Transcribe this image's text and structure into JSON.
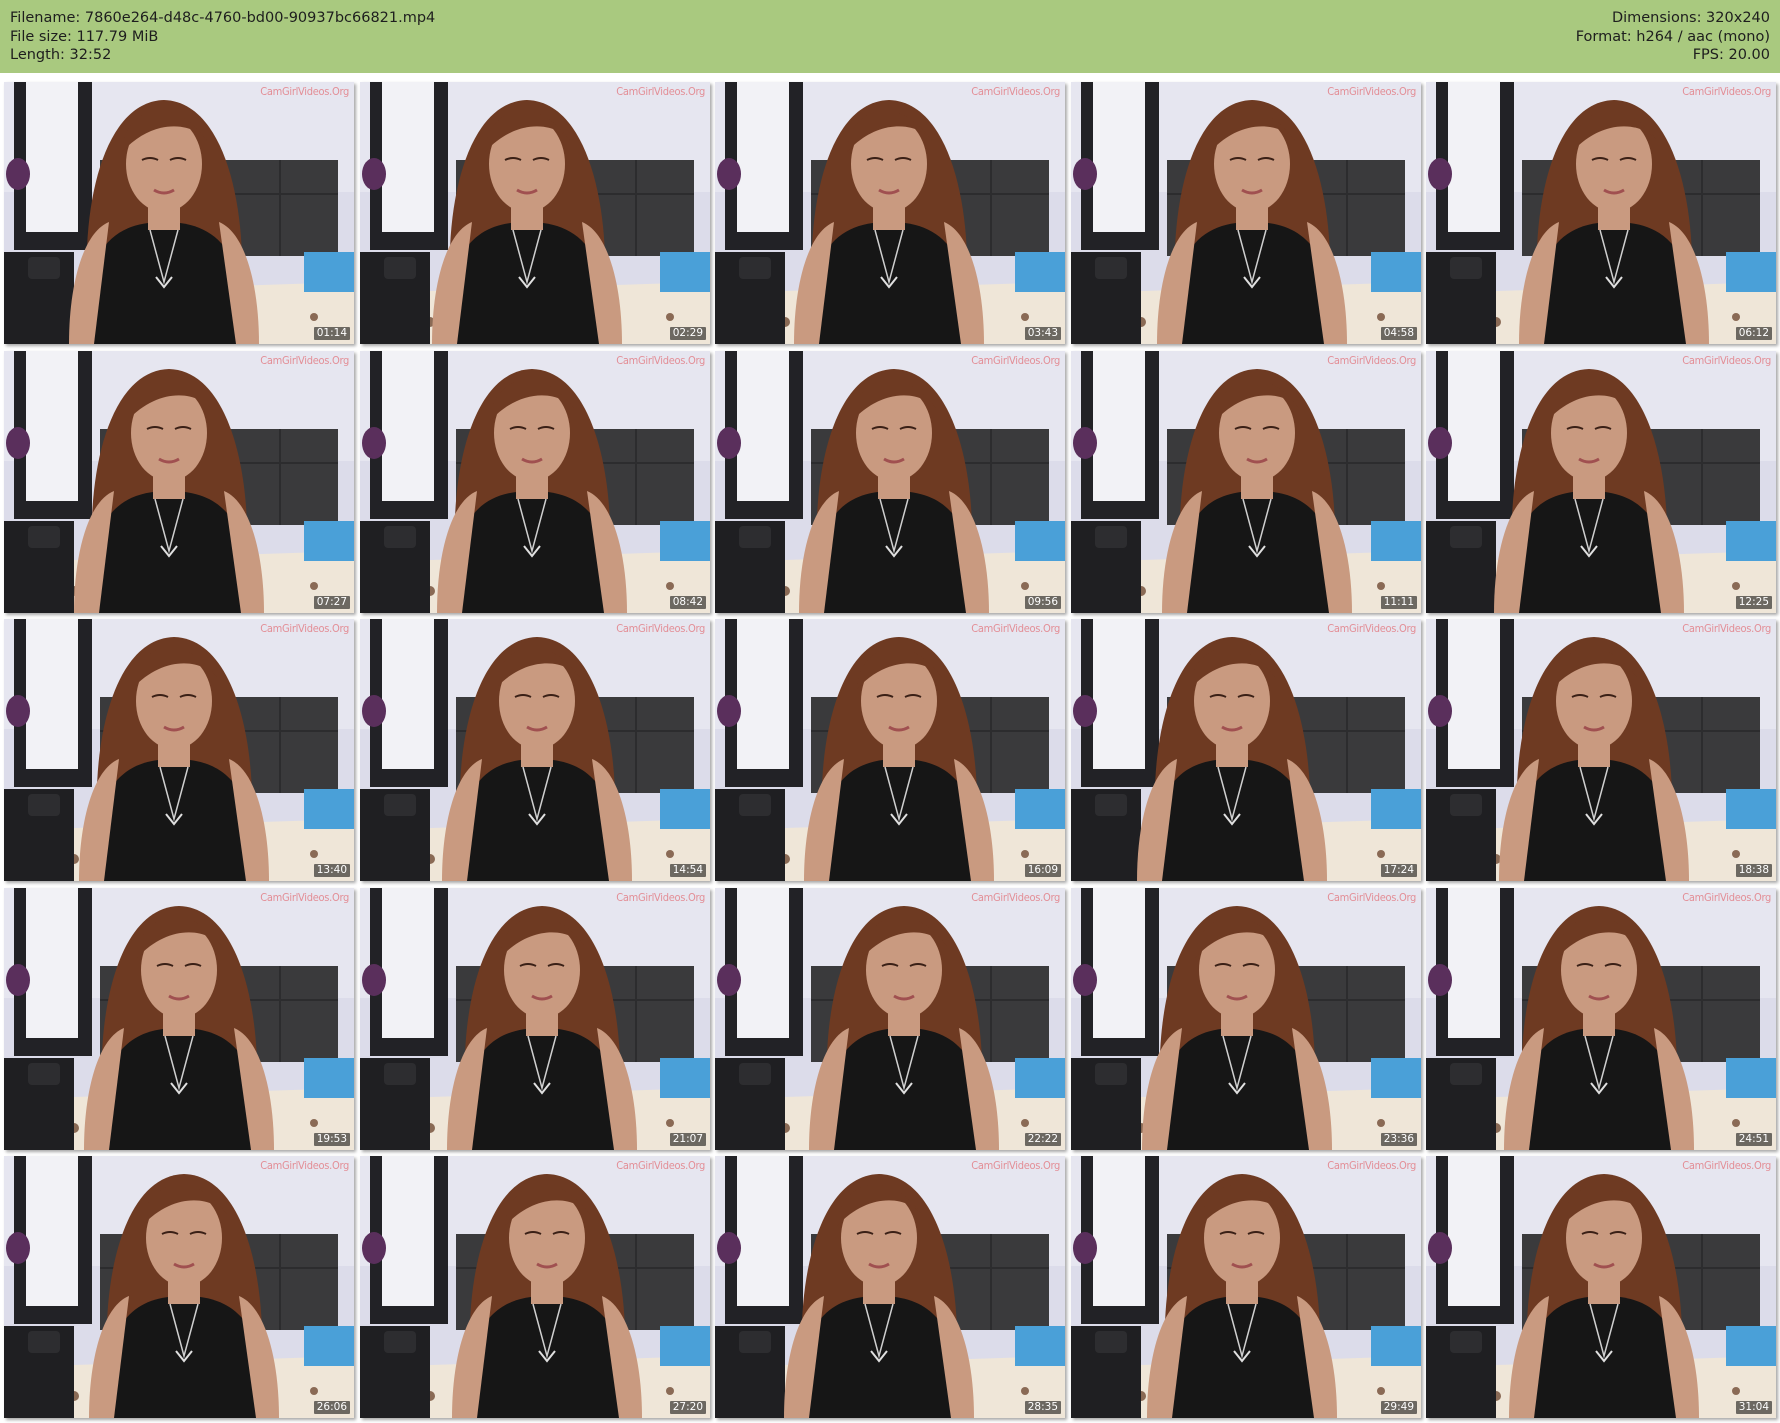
{
  "header": {
    "filename": "Filename: 7860e264-d48c-4760-bd00-90937bc66821.mp4",
    "filesize": "File size: 117.79 MiB",
    "length": "Length: 32:52",
    "dimensions": "Dimensions: 320x240",
    "format": "Format: h264 / aac (mono)",
    "fps": "FPS: 20.00"
  },
  "watermark": "CamGirlVideos.Org",
  "timestamps": [
    "01:14",
    "02:29",
    "03:43",
    "04:58",
    "06:12",
    "07:27",
    "08:42",
    "09:56",
    "11:11",
    "12:25",
    "13:40",
    "14:54",
    "16:09",
    "17:24",
    "18:38",
    "19:53",
    "21:07",
    "22:22",
    "23:36",
    "24:51",
    "26:06",
    "27:20",
    "28:35",
    "29:49",
    "31:04"
  ],
  "colors": {
    "header_bg": "#a9c97f",
    "hair": "#6e3a22",
    "skin": "#c99a80",
    "top": "#161616",
    "wall": "#dcdcea",
    "mirror_frame": "#222226",
    "headboard": "#3a3a3c"
  }
}
